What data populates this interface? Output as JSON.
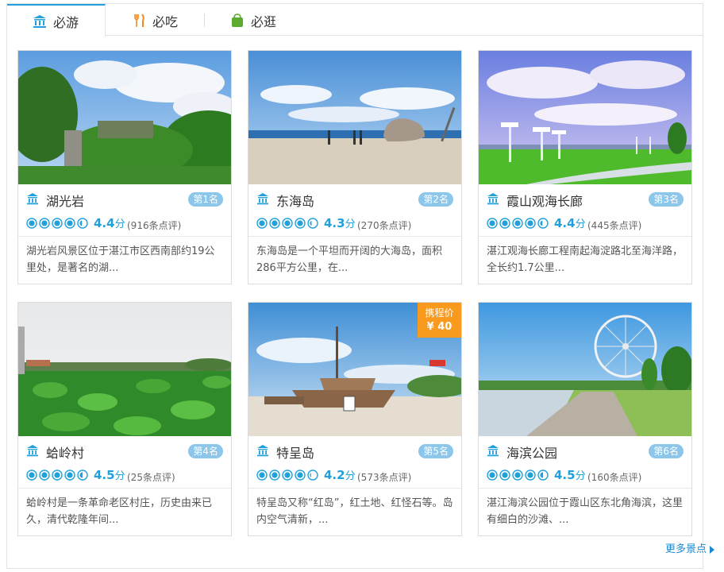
{
  "tabs": [
    {
      "label": "必游",
      "icon": "museum-icon",
      "active": true
    },
    {
      "label": "必吃",
      "icon": "fork-knife-icon",
      "active": false
    },
    {
      "label": "必逛",
      "icon": "shopping-bag-icon",
      "active": false
    }
  ],
  "cards": [
    {
      "name": "湖光岩",
      "rank": "第1名",
      "score": "4.4",
      "unit": "分",
      "reviews": "(916条点评)",
      "rating": 4.4,
      "desc": "湖光岩风景区位于湛江市区西南部约19公里处，是著名的湖..."
    },
    {
      "name": "东海岛",
      "rank": "第2名",
      "score": "4.3",
      "unit": "分",
      "reviews": "(270条点评)",
      "rating": 4.3,
      "desc": "东海岛是一个平坦而开阔的大海岛，面积286平方公里，在..."
    },
    {
      "name": "霞山观海长廊",
      "rank": "第3名",
      "score": "4.4",
      "unit": "分",
      "reviews": "(445条点评)",
      "rating": 4.4,
      "desc": "湛江观海长廊工程南起海淀路北至海洋路，全长约1.7公里..."
    },
    {
      "name": "蛤岭村",
      "rank": "第4名",
      "score": "4.5",
      "unit": "分",
      "reviews": "(25条点评)",
      "rating": 4.5,
      "desc": "蛤岭村是一条革命老区村庄，历史由来已久，清代乾隆年间..."
    },
    {
      "name": "特呈岛",
      "rank": "第5名",
      "score": "4.2",
      "unit": "分",
      "reviews": "(573条点评)",
      "rating": 4.2,
      "desc": "特呈岛又称“红岛”，红土地、红怪石等。岛内空气清新，...",
      "price_label": "携程价",
      "price": "¥ 40"
    },
    {
      "name": "海滨公园",
      "rank": "第6名",
      "score": "4.5",
      "unit": "分",
      "reviews": "(160条点评)",
      "rating": 4.5,
      "desc": "湛江海滨公园位于霞山区东北角海滨，这里有细白的沙滩、..."
    }
  ],
  "more_label": "更多景点",
  "colors": {
    "accent": "#21a0db",
    "rank_badge": "#8cc6ea",
    "price_tag": "#f79a1d",
    "link": "#1b8ad4"
  }
}
